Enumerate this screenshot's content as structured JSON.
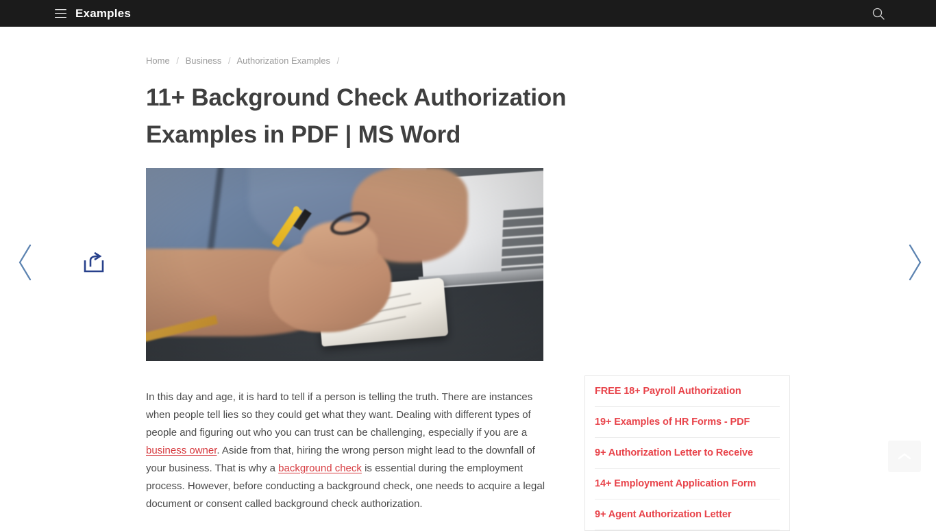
{
  "header": {
    "brand": "Examples",
    "menu_icon": "hamburger-icon",
    "search_icon": "search-icon"
  },
  "breadcrumb": {
    "items": [
      "Home",
      "Business",
      "Authorization Examples"
    ],
    "separator": "/",
    "trailing_separator": "/"
  },
  "article": {
    "title": "11+ Background Check Authorization Examples in PDF | MS Word",
    "hero_image_alt": "Man in blue shirt writing with a yellow pen on paper next to a laptop on a dark desk",
    "body": {
      "part1": "In this day and age, it is hard to tell if a person is telling the truth. There are instances when people tell lies so they could get what they want. Dealing with different types of people and figuring out who you can trust can be challenging, especially if you are a ",
      "link1": "business owner",
      "part2": ". Aside from that, hiring the wrong person might lead to the downfall of your business. That is why a ",
      "link2": "background check",
      "part3": " is essential during the employment process. However, before conducting a background check, one needs to acquire a legal document or consent called background check authorization."
    }
  },
  "related_links": {
    "items": [
      "FREE 18+ Payroll Authorization",
      "19+ Examples of HR Forms - PDF",
      "9+ Authorization Letter to Receive",
      "14+ Employment Application Form",
      "9+ Agent Authorization Letter"
    ]
  },
  "controls": {
    "prev_icon": "chevron-left-icon",
    "next_icon": "chevron-right-icon",
    "share_icon": "share-icon",
    "scroll_top_icon": "chevron-up-icon"
  },
  "colors": {
    "header_bg": "#1b1b1b",
    "link_red": "#e8434a",
    "inline_link_red": "#d63a3f",
    "title_gray": "#3f3f3f",
    "body_gray": "#4a4a4a",
    "breadcrumb_gray": "#9b9b9b",
    "chevron_blue": "#5b82b0",
    "share_navy": "#27408b"
  }
}
